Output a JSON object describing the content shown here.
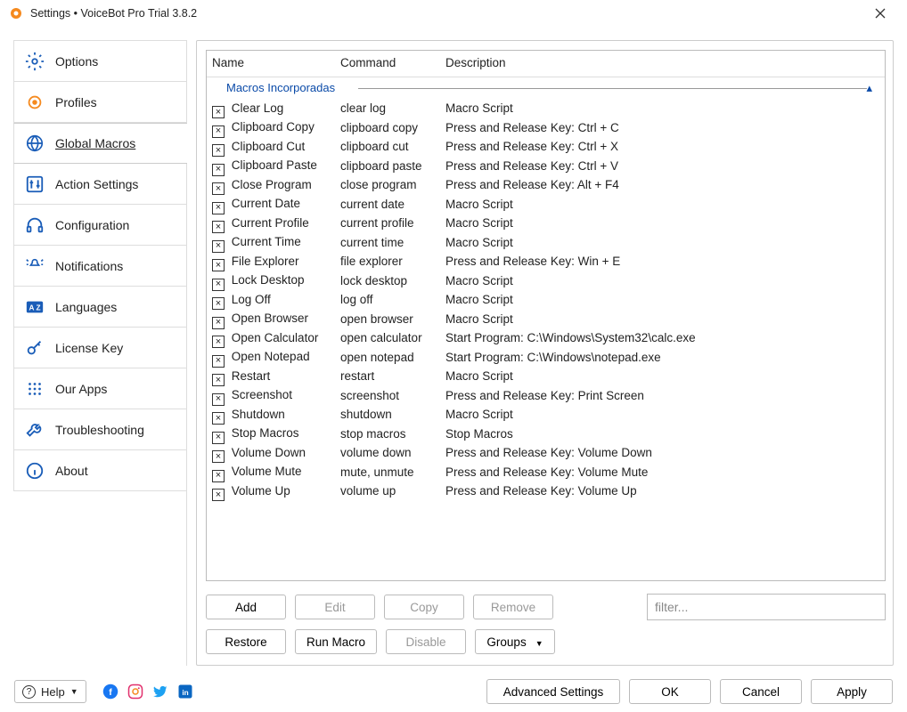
{
  "window": {
    "title": "Settings • VoiceBot Pro Trial 3.8.2"
  },
  "sidebar": {
    "items": [
      {
        "id": "options",
        "label": "Options"
      },
      {
        "id": "profiles",
        "label": "Profiles"
      },
      {
        "id": "global-macros",
        "label": "Global Macros",
        "active": true
      },
      {
        "id": "action-settings",
        "label": "Action Settings"
      },
      {
        "id": "configuration",
        "label": "Configuration"
      },
      {
        "id": "notifications",
        "label": "Notifications"
      },
      {
        "id": "languages",
        "label": "Languages"
      },
      {
        "id": "license-key",
        "label": "License Key"
      },
      {
        "id": "our-apps",
        "label": "Our Apps"
      },
      {
        "id": "troubleshooting",
        "label": "Troubleshooting"
      },
      {
        "id": "about",
        "label": "About"
      }
    ]
  },
  "table": {
    "columns": {
      "name": "Name",
      "command": "Command",
      "description": "Description"
    },
    "group": "Macros Incorporadas",
    "rows": [
      {
        "name": "Clear Log",
        "command": "clear log",
        "description": "Macro Script"
      },
      {
        "name": "Clipboard Copy",
        "command": "clipboard copy",
        "description": "Press and Release Key: Ctrl + C"
      },
      {
        "name": "Clipboard Cut",
        "command": "clipboard cut",
        "description": "Press and Release Key: Ctrl + X"
      },
      {
        "name": "Clipboard Paste",
        "command": "clipboard paste",
        "description": "Press and Release Key: Ctrl + V"
      },
      {
        "name": "Close Program",
        "command": "close program",
        "description": "Press and Release Key: Alt + F4"
      },
      {
        "name": "Current Date",
        "command": "current date",
        "description": "Macro Script"
      },
      {
        "name": "Current Profile",
        "command": "current profile",
        "description": "Macro Script"
      },
      {
        "name": "Current Time",
        "command": "current time",
        "description": "Macro Script"
      },
      {
        "name": "File Explorer",
        "command": "file explorer",
        "description": "Press and Release Key: Win + E"
      },
      {
        "name": "Lock Desktop",
        "command": "lock desktop",
        "description": "Macro Script"
      },
      {
        "name": "Log Off",
        "command": "log off",
        "description": "Macro Script"
      },
      {
        "name": "Open Browser",
        "command": "open browser",
        "description": "Macro Script"
      },
      {
        "name": "Open Calculator",
        "command": "open calculator",
        "description": "Start Program: C:\\Windows\\System32\\calc.exe"
      },
      {
        "name": "Open Notepad",
        "command": "open notepad",
        "description": "Start Program: C:\\Windows\\notepad.exe"
      },
      {
        "name": "Restart",
        "command": "restart",
        "description": "Macro Script"
      },
      {
        "name": "Screenshot",
        "command": "screenshot",
        "description": "Press and Release Key: Print Screen"
      },
      {
        "name": "Shutdown",
        "command": "shutdown",
        "description": "Macro Script"
      },
      {
        "name": "Stop Macros",
        "command": "stop macros",
        "description": "Stop Macros"
      },
      {
        "name": "Volume Down",
        "command": "volume down",
        "description": "Press and Release Key: Volume Down"
      },
      {
        "name": "Volume Mute",
        "command": "mute, unmute",
        "description": "Press and Release Key: Volume Mute"
      },
      {
        "name": "Volume Up",
        "command": "volume up",
        "description": "Press and Release Key: Volume Up"
      }
    ]
  },
  "buttons": {
    "add": "Add",
    "edit": "Edit",
    "copy": "Copy",
    "remove": "Remove",
    "restore": "Restore",
    "run_macro": "Run Macro",
    "disable": "Disable",
    "groups": "Groups"
  },
  "filter": {
    "placeholder": "filter..."
  },
  "footer": {
    "help": "Help",
    "advanced": "Advanced Settings",
    "ok": "OK",
    "cancel": "Cancel",
    "apply": "Apply"
  }
}
